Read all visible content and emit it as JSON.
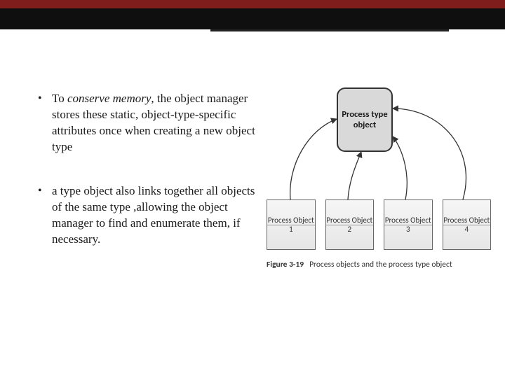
{
  "bullets": {
    "b1_pre": "To ",
    "b1_em": "conserve memory",
    "b1_post": ", the object manager stores these static, object-type-specific attributes once when creating a new object type",
    "b2": "a type object also links together all objects of the same type ,allowing the object manager to find and enumerate them, if necessary."
  },
  "diagram": {
    "type_box": "Process type object",
    "objects": [
      "Process Object 1",
      "Process Object 2",
      "Process Object 3",
      "Process Object 4"
    ],
    "caption_label": "Figure 3-19",
    "caption_text": "Process objects and the process type object"
  },
  "colors": {
    "accent_red": "#7f1d1d",
    "bar_black": "#0f0f0f"
  }
}
